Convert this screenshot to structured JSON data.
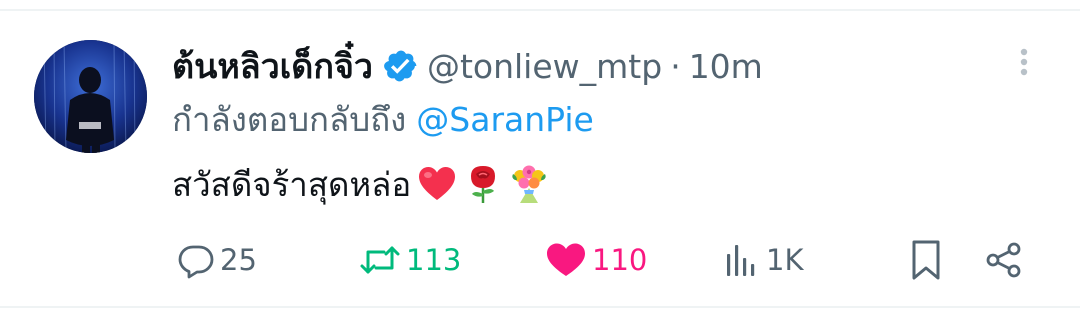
{
  "tweet": {
    "display_name": "ต้นหลิวเด็กจิ๋ว",
    "handle": "@tonliew_mtp",
    "separator": "·",
    "time": "10m",
    "reply_prefix": "กำลังตอบกลับถึง",
    "reply_to": "@SaranPie",
    "text": "สวัสดีจร้าสุดหล่อ",
    "emojis": [
      "red-heart",
      "rose",
      "bouquet"
    ]
  },
  "actions": {
    "replies": "25",
    "retweets": "113",
    "likes": "110",
    "views": "1K"
  },
  "colors": {
    "text": "#0f1419",
    "muted": "#536471",
    "link": "#1d9bf0",
    "verified": "#1d9bf0",
    "retweet_active": "#00ba7c",
    "like_active": "#f91880",
    "divider": "#eff3f4"
  },
  "icons": {
    "verified": "verified-badge-icon",
    "more": "more-vertical-icon",
    "reply": "reply-bubble-icon",
    "retweet": "retweet-icon",
    "like": "heart-filled-icon",
    "views": "views-bar-chart-icon",
    "bookmark": "bookmark-icon",
    "share": "share-icon"
  }
}
